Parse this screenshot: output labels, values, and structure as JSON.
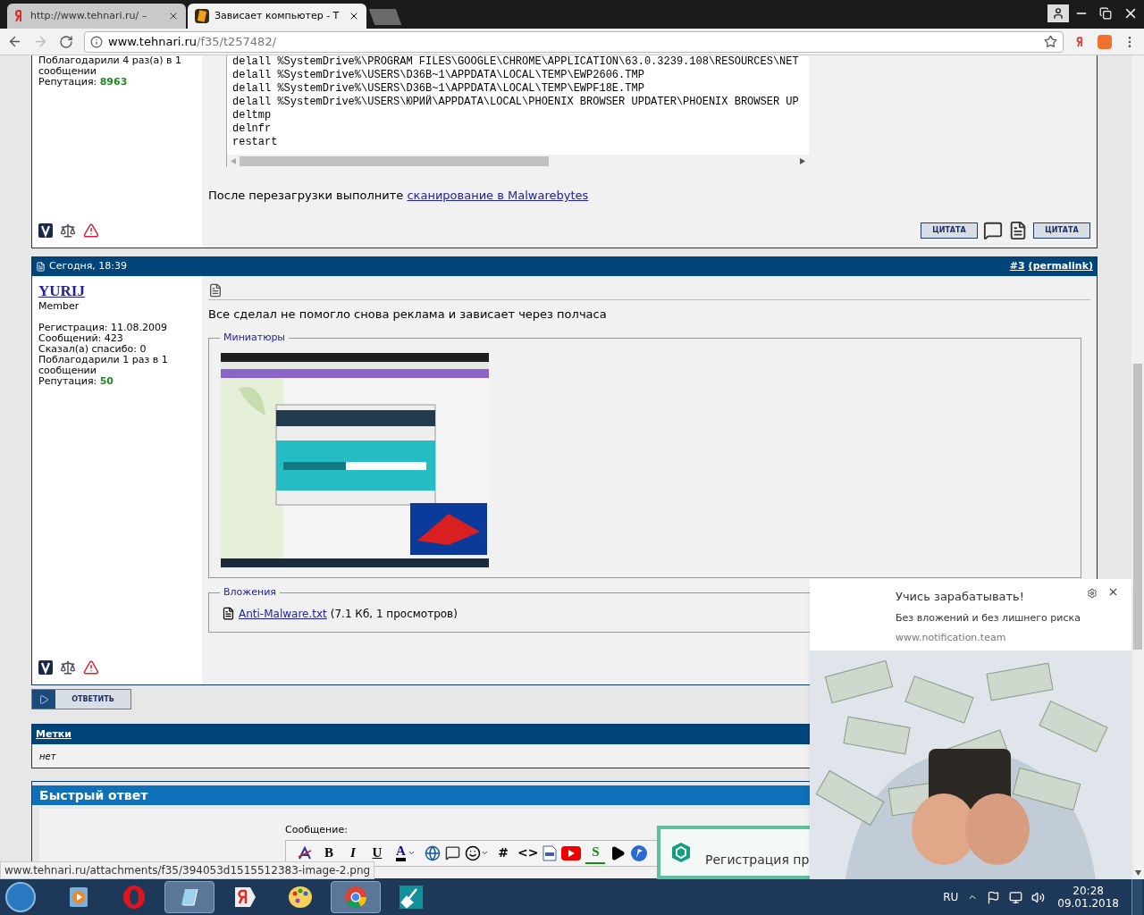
{
  "browser": {
    "tabs": [
      {
        "title": "http://www.tehnari.ru/ –",
        "kind": "yandex",
        "selected": false
      },
      {
        "title": "Зависает компьютер - Т",
        "kind": "site",
        "selected": true
      }
    ],
    "address": {
      "domain": "www.tehnari.ru",
      "path": "/f35/t257482/"
    }
  },
  "previous_post": {
    "stats": [
      "Поблагодарили 4 раз(а) в 1 сообщении"
    ],
    "reputation_label": "Репутация:",
    "reputation": "8963",
    "code_lines": [
      "delall %SystemDrive%\\PROGRAM FILES\\GOOGLE\\CHROME\\APPLICATION\\63.0.3239.108\\RESOURCES\\NET",
      "delall %SystemDrive%\\USERS\\D36B~1\\APPDATA\\LOCAL\\TEMP\\EWP2606.TMP",
      "delall %SystemDrive%\\USERS\\D36B~1\\APPDATA\\LOCAL\\TEMP\\EWPF18E.TMP",
      "delall %SystemDrive%\\USERS\\ЮРИЙ\\APPDATA\\LOCAL\\PHOENIX BROWSER UPDATER\\PHOENIX BROWSER UP",
      "deltmp",
      "delnfr",
      "restart"
    ],
    "text": "После перезагрузки выполните",
    "link": "сканирование в Malwarebytes",
    "buttons": [
      "ЦИТАТА",
      "ЦИТАТА"
    ]
  },
  "post": {
    "date": "Сегодня, 18:39",
    "number": "#3",
    "permalink": "(permalink)",
    "author": "YURIJ",
    "rank": "Member",
    "stats": [
      "Регистрация: 11.08.2009",
      "Сообщений: 423",
      "Сказал(а) спасибо: 0",
      "Поблагодарили 1 раз в 1 сообщении"
    ],
    "reputation_label": "Репутация:",
    "reputation": "50",
    "message": "Все сделал не помогло снова реклама и зависает через полчаса",
    "thumbnails_legend": "Миниатюры",
    "attachments_legend": "Вложения",
    "attachment": {
      "name": "Anti-Malware.txt",
      "info": "(7.1 Кб, 1 просмотров)"
    }
  },
  "reply_button": "ОТВЕТИТЬ",
  "tags": {
    "title": "Метки",
    "value": "нет"
  },
  "quick_reply": {
    "title": "Быстрый ответ",
    "message_label": "Сообщение:",
    "toolbar": [
      {
        "kind": "clear"
      },
      {
        "kind": "bold",
        "label": "B"
      },
      {
        "kind": "italic",
        "label": "I"
      },
      {
        "kind": "underline",
        "label": "U"
      },
      {
        "kind": "color",
        "label": "A"
      },
      {
        "kind": "link"
      },
      {
        "kind": "quote"
      },
      {
        "kind": "smiley"
      },
      {
        "kind": "text",
        "label": "#"
      },
      {
        "kind": "text",
        "label": "<>"
      },
      {
        "kind": "php"
      },
      {
        "kind": "youtube"
      },
      {
        "kind": "letter",
        "label": "S"
      },
      {
        "kind": "play"
      },
      {
        "kind": "blue"
      }
    ]
  },
  "status_url": "www.tehnari.ru/attachments/f35/394053d1515512383-image-2.png",
  "signup_popup": {
    "text": "Регистрация пр"
  },
  "notification": {
    "title": "Учись зарабатывать!",
    "body": "Без вложений и без лишнего риска",
    "domain": "www.notification.team"
  },
  "taskbar": {
    "apps": [
      {
        "kind": "media",
        "active": false
      },
      {
        "kind": "opera",
        "active": false
      },
      {
        "kind": "notepad",
        "active": true
      },
      {
        "kind": "yandex",
        "active": false
      },
      {
        "kind": "paint",
        "active": false
      },
      {
        "kind": "chrome",
        "active": true
      },
      {
        "kind": "cleaner",
        "active": false
      }
    ],
    "language": "RU",
    "time": "20:28",
    "date": "09.01.2018"
  }
}
